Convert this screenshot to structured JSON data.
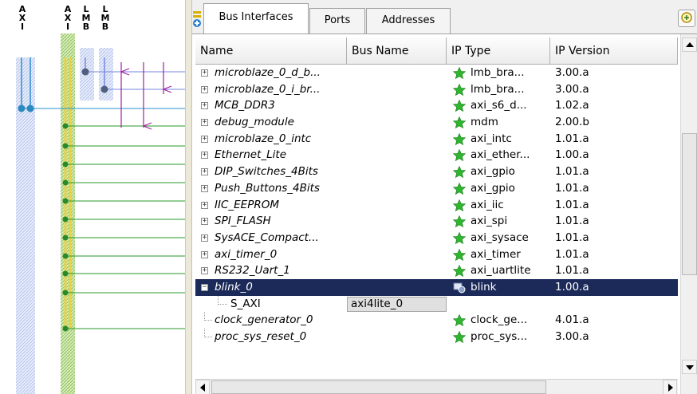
{
  "bus_panel": {
    "columns": [
      {
        "letters": [
          "A",
          "X",
          "I"
        ],
        "color": "#3b7d1d"
      },
      {
        "letters": [
          "A",
          "X",
          "I"
        ],
        "color": "#3b7d1d"
      },
      {
        "letters": [
          "L",
          "M",
          "B"
        ],
        "color": "#7a86e0"
      },
      {
        "letters": [
          "L",
          "M",
          "B"
        ],
        "color": "#7a86e0"
      }
    ]
  },
  "tabs": [
    {
      "label": "Bus Interfaces",
      "active": true
    },
    {
      "label": "Ports",
      "active": false
    },
    {
      "label": "Addresses",
      "active": false
    }
  ],
  "table": {
    "headers": [
      "Name",
      "Bus Name",
      "IP Type",
      "IP Version"
    ],
    "rows": [
      {
        "name": "microblaze_0_d_b...",
        "bus": "",
        "type": "lmb_bra...",
        "version": "3.00.a",
        "expander": "+",
        "icon": "star-icon"
      },
      {
        "name": "microblaze_0_i_br...",
        "bus": "",
        "type": "lmb_bra...",
        "version": "3.00.a",
        "expander": "+",
        "icon": "star-icon"
      },
      {
        "name": "MCB_DDR3",
        "bus": "",
        "type": "axi_s6_d...",
        "version": "1.02.a",
        "expander": "+",
        "icon": "star-icon"
      },
      {
        "name": "debug_module",
        "bus": "",
        "type": "mdm",
        "version": "2.00.b",
        "expander": "+",
        "icon": "star-icon"
      },
      {
        "name": "microblaze_0_intc",
        "bus": "",
        "type": "axi_intc",
        "version": "1.01.a",
        "expander": "+",
        "icon": "star-icon"
      },
      {
        "name": "Ethernet_Lite",
        "bus": "",
        "type": "axi_ether...",
        "version": "1.00.a",
        "expander": "+",
        "icon": "star-icon"
      },
      {
        "name": "DIP_Switches_4Bits",
        "bus": "",
        "type": "axi_gpio",
        "version": "1.01.a",
        "expander": "+",
        "icon": "star-icon"
      },
      {
        "name": "Push_Buttons_4Bits",
        "bus": "",
        "type": "axi_gpio",
        "version": "1.01.a",
        "expander": "+",
        "icon": "star-icon"
      },
      {
        "name": "IIC_EEPROM",
        "bus": "",
        "type": "axi_iic",
        "version": "1.01.a",
        "expander": "+",
        "icon": "star-icon"
      },
      {
        "name": "SPI_FLASH",
        "bus": "",
        "type": "axi_spi",
        "version": "1.01.a",
        "expander": "+",
        "icon": "star-icon"
      },
      {
        "name": "SysACE_Compact...",
        "bus": "",
        "type": "axi_sysace",
        "version": "1.01.a",
        "expander": "+",
        "icon": "star-icon"
      },
      {
        "name": "axi_timer_0",
        "bus": "",
        "type": "axi_timer",
        "version": "1.01.a",
        "expander": "+",
        "icon": "star-icon"
      },
      {
        "name": "RS232_Uart_1",
        "bus": "",
        "type": "axi_uartlite",
        "version": "1.01.a",
        "expander": "+",
        "icon": "star-icon"
      },
      {
        "name": "blink_0",
        "bus": "",
        "type": "blink",
        "version": "1.00.a",
        "expander": "−",
        "icon": "user-ip-icon",
        "selected": true
      },
      {
        "name": "S_AXI",
        "bus": "axi4lite_0",
        "type": "",
        "version": "",
        "expander": "",
        "icon": "",
        "child": true
      },
      {
        "name": "clock_generator_0",
        "bus": "",
        "type": "clock_ge...",
        "version": "4.01.a",
        "expander": "",
        "icon": "star-icon",
        "leaf": true
      },
      {
        "name": "proc_sys_reset_0",
        "bus": "",
        "type": "proc_sys...",
        "version": "3.00.a",
        "expander": "",
        "icon": "star-icon",
        "leaf": true
      }
    ]
  },
  "colors": {
    "selection": "#1c2a5a",
    "axi_bus": "#3b7d1d",
    "lmb_bus": "#7a86e0",
    "star": "#2fb52f",
    "wire_green": "#2a9a2a",
    "wire_purple": "#a020a0",
    "wire_blue": "#2b8fd0"
  }
}
